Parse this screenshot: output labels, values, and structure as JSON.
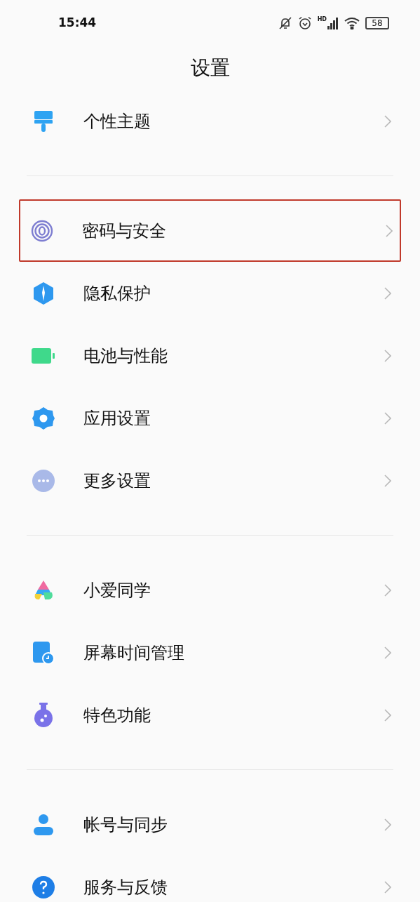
{
  "status_bar": {
    "time": "15:44",
    "network": "HD",
    "battery": "58"
  },
  "title": "设置",
  "groups": [
    {
      "items": [
        {
          "label": "个性主题",
          "highlighted": false
        }
      ]
    },
    {
      "items": [
        {
          "label": "密码与安全",
          "highlighted": true
        },
        {
          "label": "隐私保护",
          "highlighted": false
        },
        {
          "label": "电池与性能",
          "highlighted": false
        },
        {
          "label": "应用设置",
          "highlighted": false
        },
        {
          "label": "更多设置",
          "highlighted": false
        }
      ]
    },
    {
      "items": [
        {
          "label": "小爱同学",
          "highlighted": false
        },
        {
          "label": "屏幕时间管理",
          "highlighted": false
        },
        {
          "label": "特色功能",
          "highlighted": false
        }
      ]
    },
    {
      "items": [
        {
          "label": "帐号与同步",
          "highlighted": false
        },
        {
          "label": "服务与反馈",
          "highlighted": false
        }
      ]
    }
  ]
}
